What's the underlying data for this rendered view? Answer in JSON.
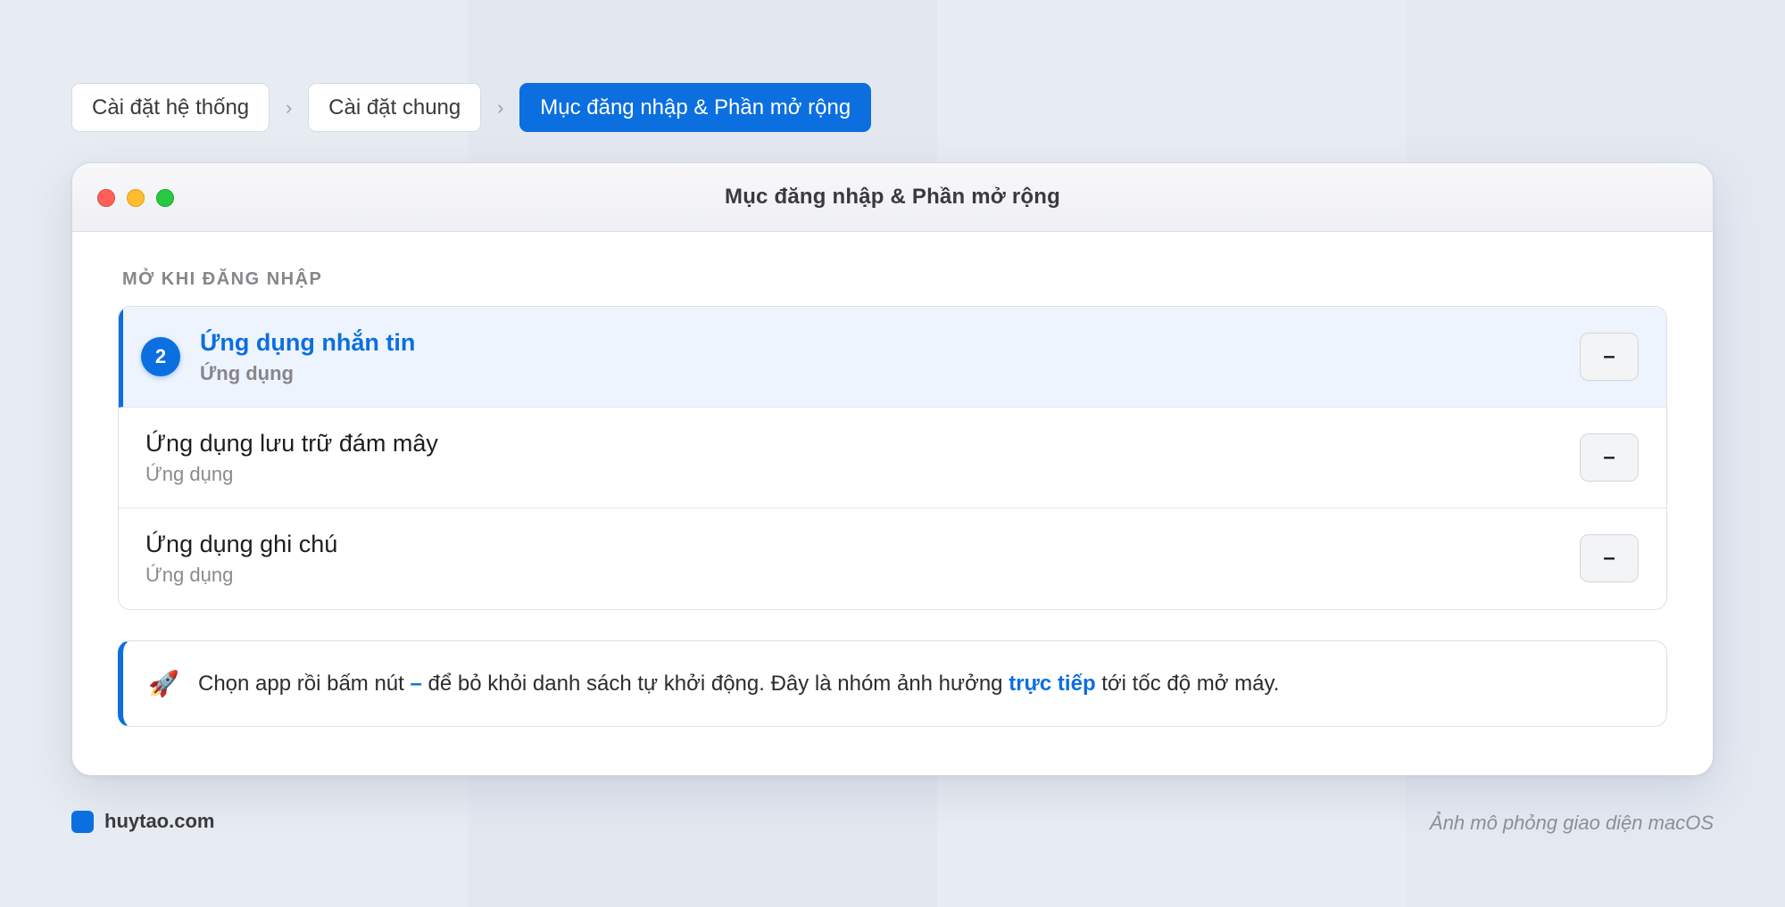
{
  "breadcrumb": {
    "items": [
      {
        "label": "Cài đặt hệ thống",
        "active": false
      },
      {
        "label": "Cài đặt chung",
        "active": false
      },
      {
        "label": "Mục đăng nhập & Phần mở rộng",
        "active": true
      }
    ],
    "separator": "›"
  },
  "window": {
    "title": "Mục đăng nhập & Phần mở rộng",
    "section_label": "MỞ KHI ĐĂNG NHẬP",
    "items": [
      {
        "name": "Ứng dụng nhắn tin",
        "kind": "Ứng dụng",
        "selected": true,
        "badge": "2",
        "remove_label": "–"
      },
      {
        "name": "Ứng dụng lưu trữ đám mây",
        "kind": "Ứng dụng",
        "selected": false,
        "remove_label": "–"
      },
      {
        "name": "Ứng dụng ghi chú",
        "kind": "Ứng dụng",
        "selected": false,
        "remove_label": "–"
      }
    ],
    "tip": {
      "icon": "rocket-icon",
      "icon_glyph": "🚀",
      "text_before": "Chọn app rồi bấm nút ",
      "dash": "–",
      "text_middle": " để bỏ khỏi danh sách tự khởi động. Đây là nhóm ảnh hưởng ",
      "strong": "trực tiếp",
      "text_after": " tới tốc độ mở máy."
    }
  },
  "footer": {
    "brand": "huytao.com",
    "note": "Ảnh mô phỏng giao diện macOS"
  },
  "colors": {
    "accent": "#0b6fe0",
    "traffic_red": "#fe5f57",
    "traffic_yellow": "#febc2e",
    "traffic_green": "#28c840"
  }
}
